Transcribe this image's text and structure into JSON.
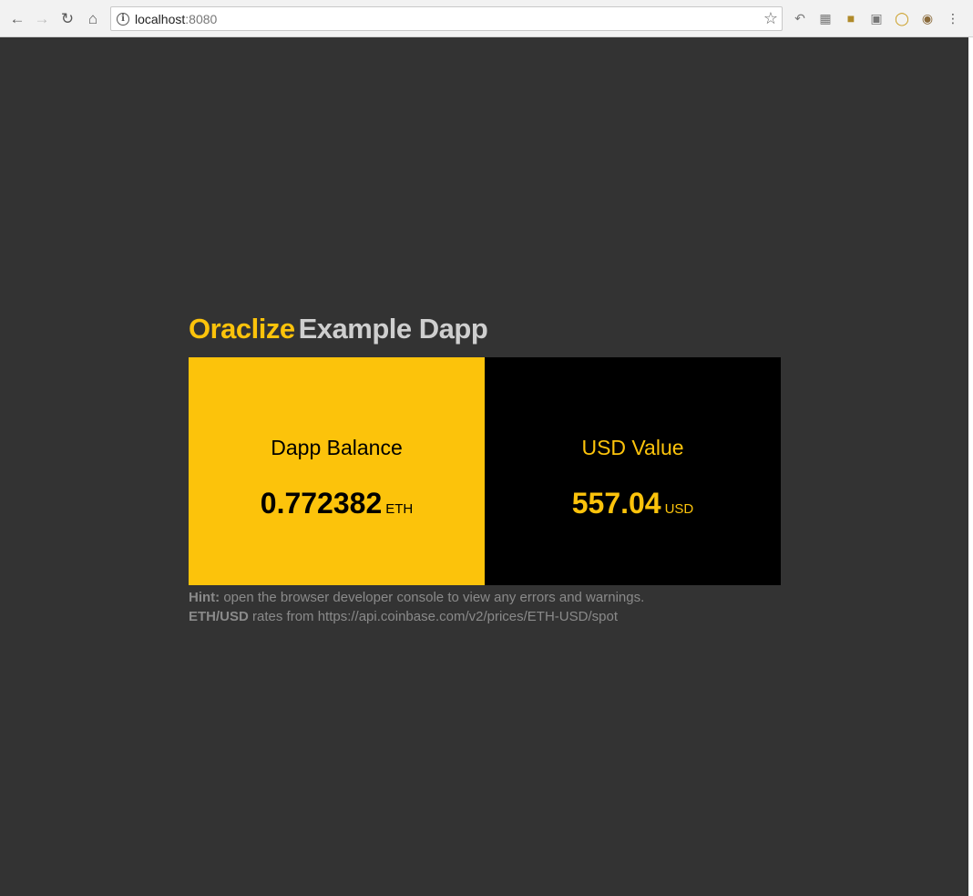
{
  "browser": {
    "url_host": "localhost",
    "url_port": ":8080",
    "icons": {
      "back": "arrow-left",
      "forward": "arrow-right",
      "reload": "circular-arrow",
      "home": "house",
      "info": "info-circle",
      "bookmark": "star"
    }
  },
  "page": {
    "title_brand": "Oraclize",
    "title_rest": "Example Dapp",
    "balance": {
      "label": "Dapp Balance",
      "value": "0.772382",
      "unit": "ETH"
    },
    "usd": {
      "label": "USD Value",
      "value": "557.04",
      "unit": "USD"
    },
    "hint": {
      "hint_label": "Hint:",
      "hint_text": " open the browser developer console to view any errors and warnings.",
      "rates_label": "ETH/USD",
      "rates_text": " rates from https://api.coinbase.com/v2/prices/ETH-USD/spot"
    }
  },
  "colors": {
    "accent": "#fcc30b",
    "background": "#333333",
    "card_dark": "#000000",
    "title_light": "#cfcfcf",
    "hint_text": "#8a8a8a"
  }
}
